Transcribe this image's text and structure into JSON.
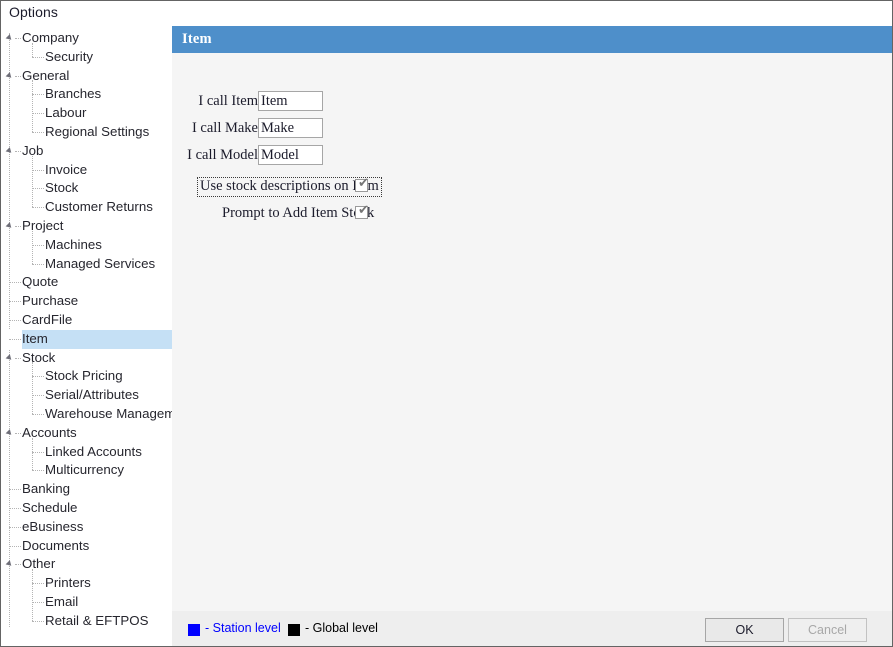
{
  "window": {
    "title": "Options"
  },
  "sidebar": {
    "name": "options-tree",
    "items": [
      {
        "label": "Company",
        "level": 0,
        "expander": true,
        "selected": false
      },
      {
        "label": "Security",
        "level": 1,
        "expander": false,
        "selected": false
      },
      {
        "label": "General",
        "level": 0,
        "expander": true,
        "selected": false
      },
      {
        "label": "Branches",
        "level": 1,
        "expander": false,
        "selected": false
      },
      {
        "label": "Labour",
        "level": 1,
        "expander": false,
        "selected": false
      },
      {
        "label": "Regional Settings",
        "level": 1,
        "expander": false,
        "selected": false
      },
      {
        "label": "Job",
        "level": 0,
        "expander": true,
        "selected": false
      },
      {
        "label": "Invoice",
        "level": 1,
        "expander": false,
        "selected": false
      },
      {
        "label": "Stock",
        "level": 1,
        "expander": false,
        "selected": false
      },
      {
        "label": "Customer Returns",
        "level": 1,
        "expander": false,
        "selected": false
      },
      {
        "label": "Project",
        "level": 0,
        "expander": true,
        "selected": false
      },
      {
        "label": "Machines",
        "level": 1,
        "expander": false,
        "selected": false
      },
      {
        "label": "Managed Services",
        "level": 1,
        "expander": false,
        "selected": false
      },
      {
        "label": "Quote",
        "level": 0,
        "expander": false,
        "selected": false
      },
      {
        "label": "Purchase",
        "level": 0,
        "expander": false,
        "selected": false
      },
      {
        "label": "CardFile",
        "level": 0,
        "expander": false,
        "selected": false
      },
      {
        "label": "Item",
        "level": 0,
        "expander": false,
        "selected": true
      },
      {
        "label": "Stock",
        "level": 0,
        "expander": true,
        "selected": false
      },
      {
        "label": "Stock Pricing",
        "level": 1,
        "expander": false,
        "selected": false
      },
      {
        "label": "Serial/Attributes",
        "level": 1,
        "expander": false,
        "selected": false
      },
      {
        "label": "Warehouse Management",
        "level": 1,
        "expander": false,
        "selected": false
      },
      {
        "label": "Accounts",
        "level": 0,
        "expander": true,
        "selected": false
      },
      {
        "label": "Linked Accounts",
        "level": 1,
        "expander": false,
        "selected": false
      },
      {
        "label": "Multicurrency",
        "level": 1,
        "expander": false,
        "selected": false
      },
      {
        "label": "Banking",
        "level": 0,
        "expander": false,
        "selected": false
      },
      {
        "label": "Schedule",
        "level": 0,
        "expander": false,
        "selected": false
      },
      {
        "label": "eBusiness",
        "level": 0,
        "expander": false,
        "selected": false
      },
      {
        "label": "Documents",
        "level": 0,
        "expander": false,
        "selected": false
      },
      {
        "label": "Other",
        "level": 0,
        "expander": true,
        "selected": false
      },
      {
        "label": "Printers",
        "level": 1,
        "expander": false,
        "selected": false
      },
      {
        "label": "Email",
        "level": 1,
        "expander": false,
        "selected": false
      },
      {
        "label": "Retail & EFTPOS",
        "level": 1,
        "expander": false,
        "selected": false
      }
    ]
  },
  "main": {
    "header_title": "Item",
    "fields": [
      {
        "label": "I call Item",
        "value": "Item"
      },
      {
        "label": "I call Make",
        "value": "Make"
      },
      {
        "label": "I call Model",
        "value": "Model"
      }
    ],
    "checkboxes": [
      {
        "label": "Use stock descriptions on Item",
        "checked": true,
        "focused": true,
        "check_glyph": "✔"
      },
      {
        "label": "Prompt to Add Item Stock",
        "checked": true,
        "focused": false,
        "check_glyph": "✔"
      }
    ]
  },
  "footer": {
    "legend": [
      {
        "text": "- Station level",
        "color": "#0000ff"
      },
      {
        "text": "- Global level",
        "color": "#000000"
      }
    ],
    "buttons": {
      "ok": "OK",
      "cancel": "Cancel"
    }
  },
  "colors": {
    "header_blue": "#4e8fca",
    "selection_blue": "#c5e0f5",
    "content_bg": "#f5f5f5",
    "footer_bg": "#eeeeee",
    "station_level": "#0000ff",
    "global_level": "#000000"
  }
}
